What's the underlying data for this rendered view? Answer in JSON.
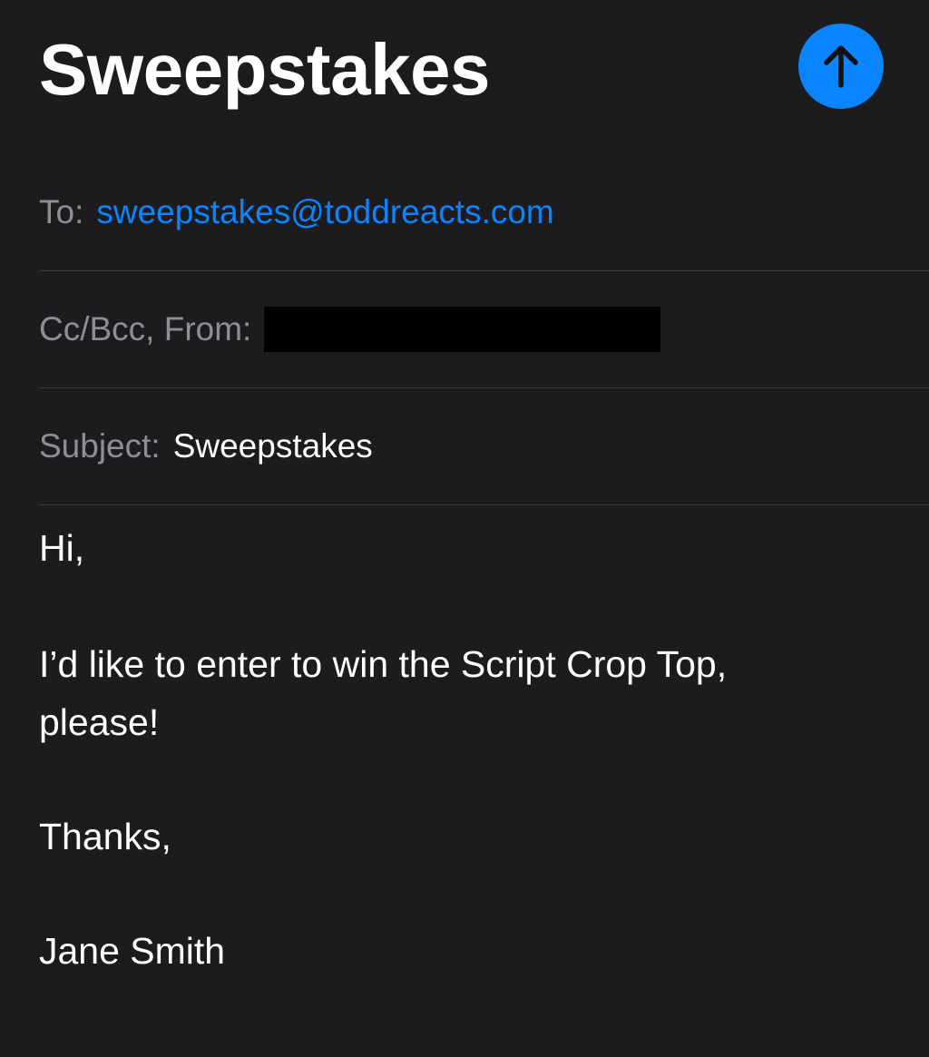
{
  "compose": {
    "title": "Sweepstakes",
    "send_icon": "arrow-up-icon",
    "accent_color": "#0a84ff",
    "to": {
      "label": "To:",
      "address": "sweepstakes@toddreacts.com"
    },
    "cc_bcc_from": {
      "label": "Cc/Bcc, From:"
    },
    "subject": {
      "label": "Subject:",
      "value": "Sweepstakes"
    },
    "body": {
      "greeting": "Hi,",
      "message_line_1": "I’d like to enter to win the Script Crop Top,",
      "message_line_2": "please!",
      "closing": "Thanks,",
      "signature": "Jane Smith"
    }
  }
}
